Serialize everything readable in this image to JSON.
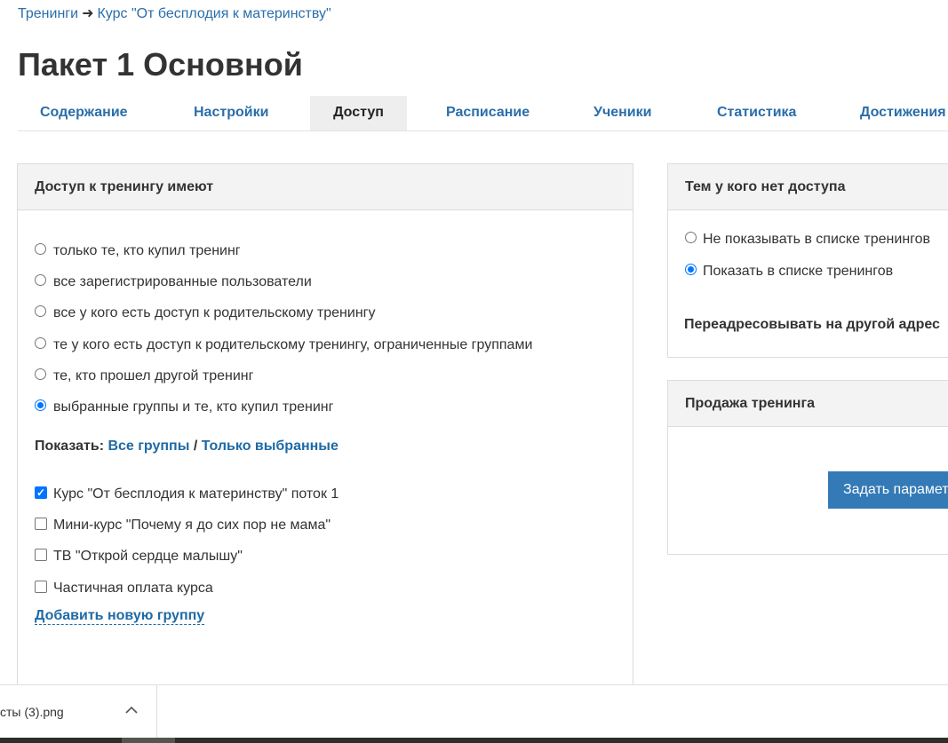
{
  "breadcrumb": {
    "parent": "Тренинги",
    "arrow": "➜",
    "current": "Курс \"От бесплодия к материнству\""
  },
  "page_title": "Пакет 1 Основной",
  "tabs": [
    {
      "label": "Содержание",
      "active": false
    },
    {
      "label": "Настройки",
      "active": false
    },
    {
      "label": "Доступ",
      "active": true
    },
    {
      "label": "Расписание",
      "active": false
    },
    {
      "label": "Ученики",
      "active": false
    },
    {
      "label": "Статистика",
      "active": false
    },
    {
      "label": "Достижения",
      "active": false
    }
  ],
  "access_panel": {
    "title": "Доступ к тренингу имеют",
    "options": [
      {
        "label": "только те, кто купил тренинг",
        "checked": false
      },
      {
        "label": "все зарегистрированные пользователи",
        "checked": false
      },
      {
        "label": "все у кого есть доступ к родительскому тренингу",
        "checked": false
      },
      {
        "label": "те у кого есть доступ к родительскому тренингу, ограниченные группами",
        "checked": false
      },
      {
        "label": "те, кто прошел другой тренинг",
        "checked": false
      },
      {
        "label": "выбранные группы и те, кто купил тренинг",
        "checked": true
      }
    ],
    "show_label": "Показать:",
    "show_all": "Все группы",
    "show_sep": "/",
    "show_selected": "Только выбранные",
    "groups": [
      {
        "label": "Курс \"От бесплодия к материнству\" поток 1",
        "checked": true
      },
      {
        "label": "Мини-курс \"Почему я до сих пор не мама\"",
        "checked": false
      },
      {
        "label": "ТВ \"Открой сердце малышу\"",
        "checked": false
      },
      {
        "label": "Частичная оплата курса",
        "checked": false
      }
    ],
    "add_group": "Добавить новую группу"
  },
  "no_access_panel": {
    "title": "Тем у кого нет доступа",
    "options": [
      {
        "label": "Не показывать в списке тренингов",
        "checked": false
      },
      {
        "label": "Показать в списке тренингов",
        "checked": true
      }
    ],
    "redirect_label": "Переадресовывать на другой адрес"
  },
  "sale_panel": {
    "title": "Продажа тренинга",
    "button_label": "Задать параметры"
  },
  "download_bar": {
    "file_name": "сты (3).png",
    "chevron_icon": "chevron-up-icon"
  }
}
